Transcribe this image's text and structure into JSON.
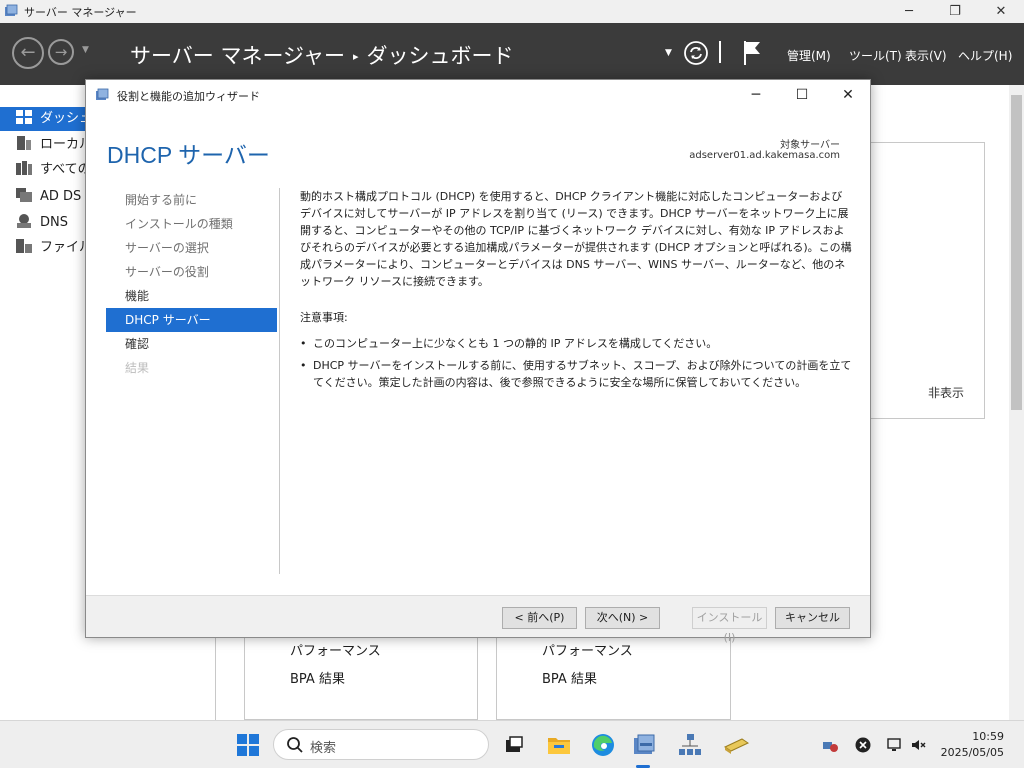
{
  "server_manager": {
    "window_title": "サーバー マネージャー",
    "breadcrumb": {
      "app": "サーバー マネージャー",
      "separator": "▸",
      "page": "ダッシュボード"
    },
    "menu": [
      "管理(M)",
      "ツール(T)",
      "表示(V)",
      "ヘルプ(H)"
    ],
    "sidebar": [
      {
        "label": "ダッシュボード",
        "icon": "dashboard-icon",
        "active": true
      },
      {
        "label": "ローカル サーバー",
        "icon": "local-server-icon"
      },
      {
        "label": "すべてのサーバー",
        "icon": "all-servers-icon"
      },
      {
        "label": "AD DS",
        "icon": "ad-ds-icon"
      },
      {
        "label": "DNS",
        "icon": "dns-icon"
      },
      {
        "label": "ファイル サービス",
        "icon": "file-services-icon"
      }
    ],
    "hide_link": "非表示",
    "tiles": [
      {
        "rows": [
          "パフォーマンス",
          "BPA 結果"
        ]
      },
      {
        "rows": [
          "パフォーマンス",
          "BPA 結果"
        ]
      }
    ]
  },
  "wizard": {
    "window_title": "役割と機能の追加ウィザード",
    "page_title": "DHCP サーバー",
    "destination_label": "対象サーバー",
    "destination_server": "adserver01.ad.kakemasa.com",
    "steps": [
      {
        "label": "開始する前に",
        "state": "normal"
      },
      {
        "label": "インストールの種類",
        "state": "normal"
      },
      {
        "label": "サーバーの選択",
        "state": "normal"
      },
      {
        "label": "サーバーの役割",
        "state": "normal"
      },
      {
        "label": "機能",
        "state": "done"
      },
      {
        "label": "DHCP サーバー",
        "state": "active"
      },
      {
        "label": "確認",
        "state": "done"
      },
      {
        "label": "結果",
        "state": "disabled"
      }
    ],
    "description": "動的ホスト構成プロトコル (DHCP) を使用すると、DHCP クライアント機能に対応したコンピューターおよびデバイスに対してサーバーが IP アドレスを割り当て (リース) できます。DHCP サーバーをネットワーク上に展開すると、コンピューターやその他の TCP/IP に基づくネットワーク デバイスに対し、有効な IP アドレスおよびそれらのデバイスが必要とする追加構成パラメーターが提供されます (DHCP オプションと呼ばれる)。この構成パラメーターにより、コンピューターとデバイスは DNS サーバー、WINS サーバー、ルーターなど、他のネットワーク リソースに接続できます。",
    "notes_heading": "注意事項:",
    "notes": [
      "このコンピューター上に少なくとも 1 つの静的 IP アドレスを構成してください。",
      "DHCP サーバーをインストールする前に、使用するサブネット、スコープ、および除外についての計画を立ててください。策定した計画の内容は、後で参照できるように安全な場所に保管しておいてください。"
    ],
    "buttons": {
      "previous": "< 前へ(P)",
      "next": "次へ(N) >",
      "install": "インストール(I)",
      "cancel": "キャンセル"
    }
  },
  "taskbar": {
    "search_placeholder": "検索",
    "apps": [
      "start-icon",
      "task-view-icon",
      "file-explorer-icon",
      "edge-icon",
      "server-manager-icon",
      "network-icon",
      "folder-tool-icon"
    ],
    "time": "10:59",
    "date": "2025/05/05"
  },
  "colors": {
    "accent": "#1f6fd1",
    "header_bg": "#3b3b3b",
    "title_blue": "#1e64ad"
  }
}
